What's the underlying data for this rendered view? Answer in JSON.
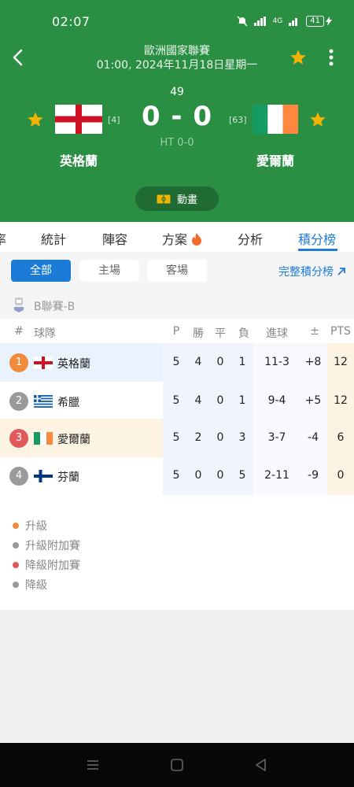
{
  "status_bar": {
    "time": "02:07",
    "battery": "41",
    "network": "4G"
  },
  "header": {
    "league_title": "歐洲國家聯賽",
    "match_time": "01:00, 2024年11月18日星期一",
    "minute": "49",
    "score": "0 - 0",
    "half_time": "HT 0-0",
    "home": {
      "name": "英格蘭",
      "rank": "[4]"
    },
    "away": {
      "name": "愛爾蘭",
      "rank": "[63]"
    },
    "animation_label": "動畫",
    "star_color": "#f5b301",
    "header_color": "#2a8f43"
  },
  "tabs": [
    "率",
    "統計",
    "陣容",
    "方案",
    "分析",
    "積分榜"
  ],
  "active_tab": "積分榜",
  "filter": {
    "chips": [
      "全部",
      "主場",
      "客場"
    ],
    "active": "全部",
    "full_table_link": "完整積分榜"
  },
  "group": {
    "label": "B聯賽-B"
  },
  "table": {
    "headers": {
      "rank": "#",
      "team": "球隊",
      "p": "P",
      "w": "勝",
      "d": "平",
      "l": "負",
      "goals": "進球",
      "diff": "±",
      "pts": "PTS"
    },
    "rows": [
      {
        "rank": "1",
        "team": "英格蘭",
        "p": "5",
        "w": "4",
        "d": "0",
        "l": "1",
        "goals": "11-3",
        "diff": "+8",
        "pts": "12"
      },
      {
        "rank": "2",
        "team": "希臘",
        "p": "5",
        "w": "4",
        "d": "0",
        "l": "1",
        "goals": "9-4",
        "diff": "+5",
        "pts": "12"
      },
      {
        "rank": "3",
        "team": "愛爾蘭",
        "p": "5",
        "w": "2",
        "d": "0",
        "l": "3",
        "goals": "3-7",
        "diff": "-4",
        "pts": "6"
      },
      {
        "rank": "4",
        "team": "芬蘭",
        "p": "5",
        "w": "0",
        "d": "0",
        "l": "5",
        "goals": "2-11",
        "diff": "-9",
        "pts": "0"
      }
    ]
  },
  "legend": [
    {
      "label": "升級",
      "color": "#f08a3c"
    },
    {
      "label": "升級附加賽",
      "color": "#999999"
    },
    {
      "label": "降級附加賽",
      "color": "#e05a5a"
    },
    {
      "label": "降級",
      "color": "#999999"
    }
  ],
  "colors": {
    "accent": "#1b7bd6",
    "rank1": "#f08a3c",
    "rank2": "#9a9a9a",
    "rank3": "#e05a5a",
    "rank4": "#9a9a9a"
  }
}
